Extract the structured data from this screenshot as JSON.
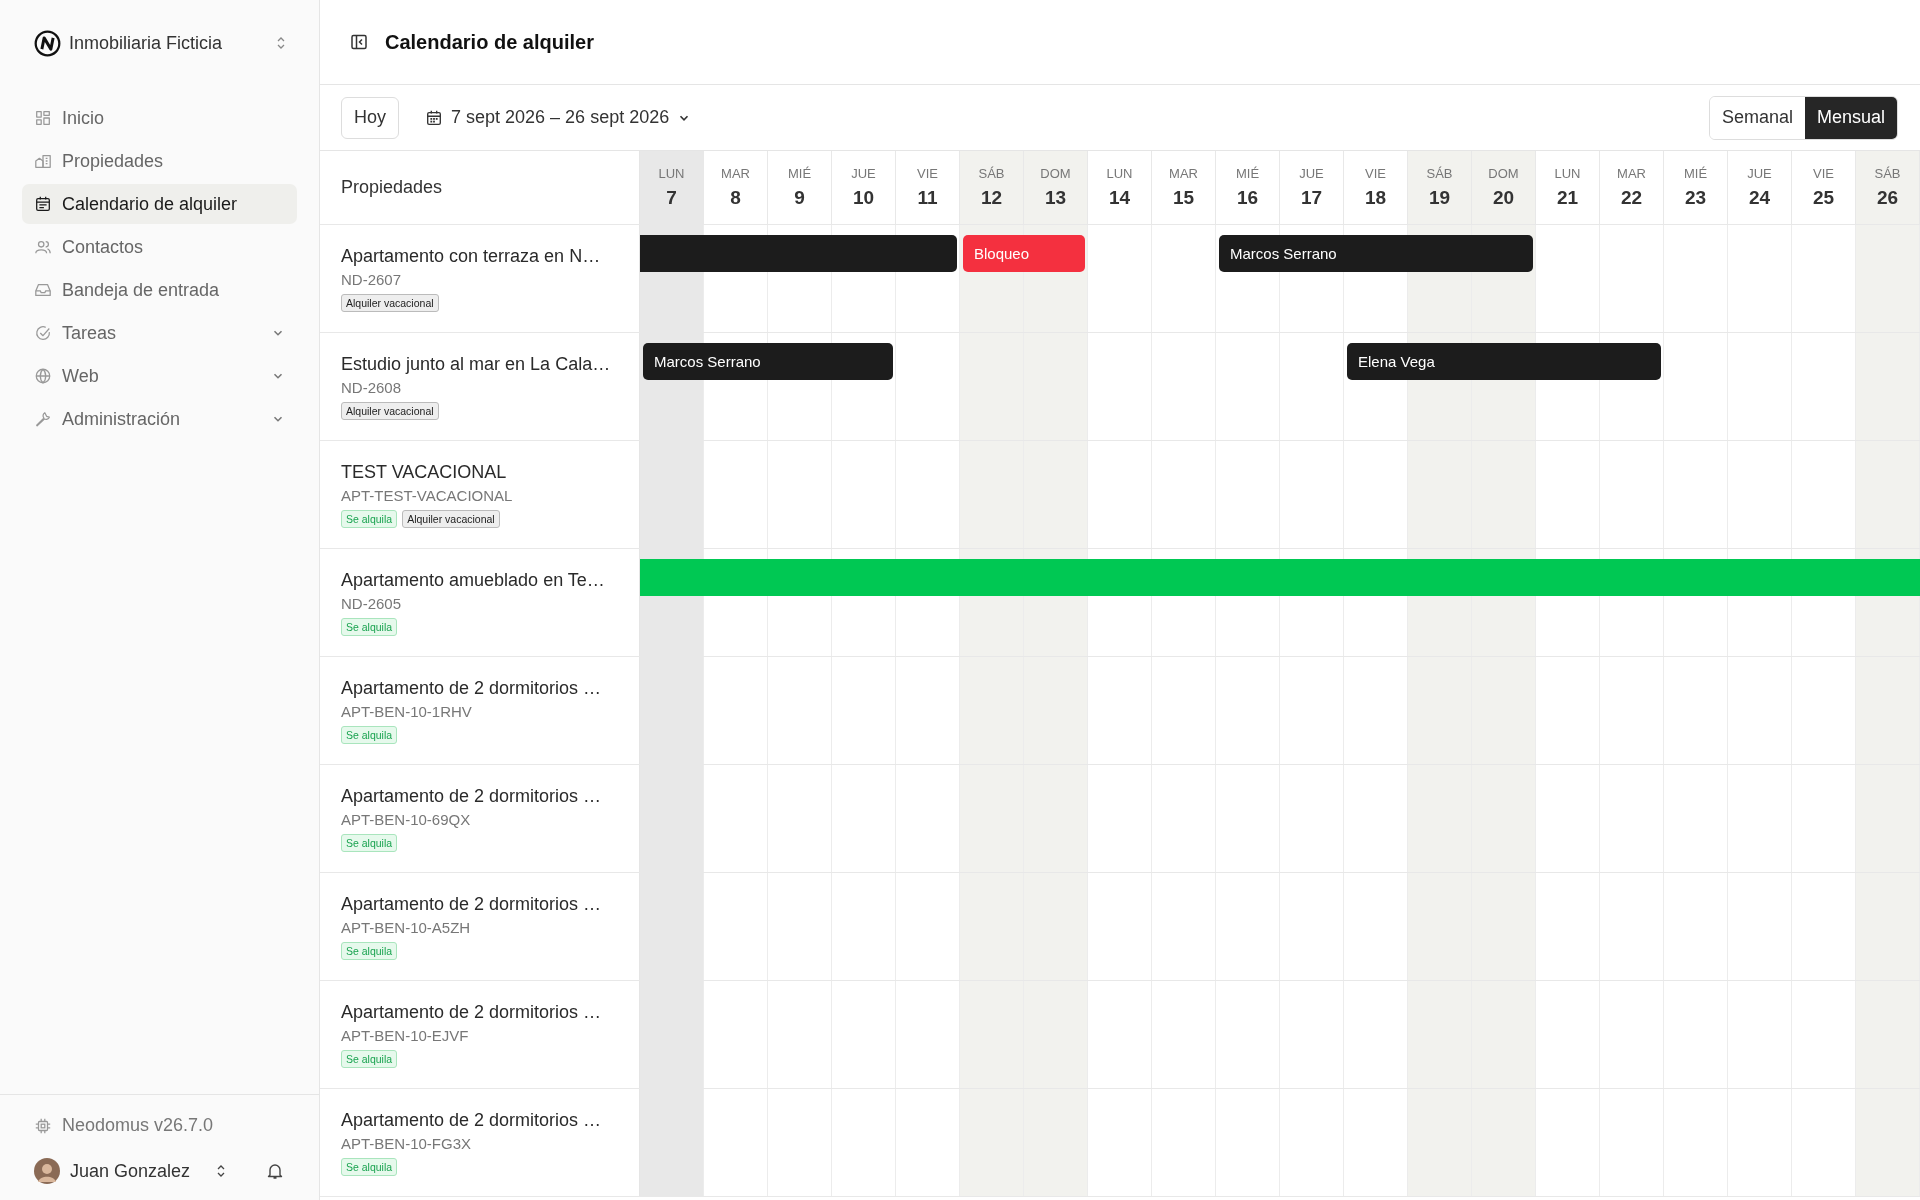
{
  "sidebar": {
    "org": "Inmobiliaria Ficticia",
    "items": [
      {
        "label": "Inicio",
        "selected": false,
        "expandable": false
      },
      {
        "label": "Propiedades",
        "selected": false,
        "expandable": false
      },
      {
        "label": "Calendario de alquiler",
        "selected": true,
        "expandable": false
      },
      {
        "label": "Contactos",
        "selected": false,
        "expandable": false
      },
      {
        "label": "Bandeja de entrada",
        "selected": false,
        "expandable": false
      },
      {
        "label": "Tareas",
        "selected": false,
        "expandable": true
      },
      {
        "label": "Web",
        "selected": false,
        "expandable": true
      },
      {
        "label": "Administración",
        "selected": false,
        "expandable": true
      }
    ],
    "version": "Neodomus v26.7.0",
    "user": "Juan Gonzalez"
  },
  "page_title": "Calendario de alquiler",
  "toolbar": {
    "today_button": "Hoy",
    "range": "7 sept 2026 – 26 sept 2026",
    "views": [
      {
        "label": "Semanal",
        "selected": false
      },
      {
        "label": "Mensual",
        "selected": true
      }
    ]
  },
  "calendar": {
    "properties_heading": "Propiedades",
    "days": [
      {
        "weekday": "LUN",
        "day": "7",
        "today": true,
        "weekend": false
      },
      {
        "weekday": "MAR",
        "day": "8",
        "today": false,
        "weekend": false
      },
      {
        "weekday": "MIÉ",
        "day": "9",
        "today": false,
        "weekend": false
      },
      {
        "weekday": "JUE",
        "day": "10",
        "today": false,
        "weekend": false
      },
      {
        "weekday": "VIE",
        "day": "11",
        "today": false,
        "weekend": false
      },
      {
        "weekday": "SÁB",
        "day": "12",
        "today": false,
        "weekend": true
      },
      {
        "weekday": "DOM",
        "day": "13",
        "today": false,
        "weekend": true
      },
      {
        "weekday": "LUN",
        "day": "14",
        "today": false,
        "weekend": false
      },
      {
        "weekday": "MAR",
        "day": "15",
        "today": false,
        "weekend": false
      },
      {
        "weekday": "MIÉ",
        "day": "16",
        "today": false,
        "weekend": false
      },
      {
        "weekday": "JUE",
        "day": "17",
        "today": false,
        "weekend": false
      },
      {
        "weekday": "VIE",
        "day": "18",
        "today": false,
        "weekend": false
      },
      {
        "weekday": "SÁB",
        "day": "19",
        "today": false,
        "weekend": true
      },
      {
        "weekday": "DOM",
        "day": "20",
        "today": false,
        "weekend": true
      },
      {
        "weekday": "LUN",
        "day": "21",
        "today": false,
        "weekend": false
      },
      {
        "weekday": "MAR",
        "day": "22",
        "today": false,
        "weekend": false
      },
      {
        "weekday": "MIÉ",
        "day": "23",
        "today": false,
        "weekend": false
      },
      {
        "weekday": "JUE",
        "day": "24",
        "today": false,
        "weekend": false
      },
      {
        "weekday": "VIE",
        "day": "25",
        "today": false,
        "weekend": false
      },
      {
        "weekday": "SÁB",
        "day": "26",
        "today": false,
        "weekend": true
      }
    ],
    "properties": [
      {
        "name": "Apartamento con terraza en N…",
        "code": "ND-2607",
        "tags": [
          {
            "label": "Alquiler vacacional",
            "kind": "type"
          }
        ],
        "slots": [
          {
            "kind": "booking"
          },
          {
            "kind": "booking"
          },
          {
            "kind": "booking"
          },
          {
            "kind": "booking"
          },
          {
            "kind": "booking"
          },
          {
            "kind": "block"
          },
          {
            "kind": "block"
          },
          {
            "kind": "free"
          },
          {
            "kind": "free"
          },
          {
            "kind": "booking"
          },
          {
            "kind": "booking"
          },
          {
            "kind": "booking"
          },
          {
            "kind": "booking"
          },
          {
            "kind": "booking"
          },
          {
            "kind": "free"
          },
          {
            "kind": "free"
          },
          {
            "kind": "free"
          },
          {
            "kind": "free"
          },
          {
            "kind": "free"
          },
          {
            "kind": "free"
          }
        ],
        "bars": [
          {
            "continues_before": true,
            "continues_after": false
          },
          {
            "label": "Bloqueo",
            "continues_before": false,
            "continues_after": false
          },
          {
            "label": "Marcos Serrano",
            "continues_before": false,
            "continues_after": false
          }
        ]
      },
      {
        "name": "Estudio junto al mar en La Cala…",
        "code": "ND-2608",
        "tags": [
          {
            "label": "Alquiler vacacional",
            "kind": "type"
          }
        ],
        "slots": [
          {
            "kind": "booking"
          },
          {
            "kind": "booking"
          },
          {
            "kind": "booking"
          },
          {
            "kind": "booking"
          },
          {
            "kind": "free"
          },
          {
            "kind": "free"
          },
          {
            "kind": "free"
          },
          {
            "kind": "free"
          },
          {
            "kind": "free"
          },
          {
            "kind": "free"
          },
          {
            "kind": "free"
          },
          {
            "kind": "booking"
          },
          {
            "kind": "booking"
          },
          {
            "kind": "booking"
          },
          {
            "kind": "booking"
          },
          {
            "kind": "booking"
          },
          {
            "kind": "free"
          },
          {
            "kind": "free"
          },
          {
            "kind": "free"
          },
          {
            "kind": "free"
          }
        ],
        "bars": [
          {
            "label": "Marcos Serrano",
            "continues_before": false,
            "continues_after": false
          },
          {
            "label": "Elena Vega",
            "continues_before": false,
            "continues_after": false
          }
        ]
      },
      {
        "name": "TEST VACACIONAL",
        "code": "APT-TEST-VACACIONAL",
        "tags": [
          {
            "label": "Se alquila",
            "kind": "rent"
          },
          {
            "label": "Alquiler vacacional",
            "kind": "type"
          }
        ]
      },
      {
        "name": "Apartamento amueblado en Te…",
        "code": "ND-2605",
        "tags": [
          {
            "label": "Se alquila",
            "kind": "rent"
          }
        ],
        "slots": [
          {
            "kind": "rental"
          },
          {
            "kind": "rental"
          },
          {
            "kind": "rental"
          },
          {
            "kind": "rental"
          },
          {
            "kind": "rental"
          },
          {
            "kind": "rental"
          },
          {
            "kind": "rental"
          },
          {
            "kind": "rental"
          },
          {
            "kind": "rental"
          },
          {
            "kind": "rental"
          },
          {
            "kind": "rental"
          },
          {
            "kind": "rental"
          },
          {
            "kind": "rental"
          },
          {
            "kind": "rental"
          },
          {
            "kind": "rental"
          },
          {
            "kind": "rental"
          },
          {
            "kind": "rental"
          },
          {
            "kind": "rental"
          },
          {
            "kind": "rental"
          },
          {
            "kind": "rental"
          }
        ],
        "bars": [
          {
            "continues_before": true,
            "continues_after": true
          }
        ]
      },
      {
        "name": "Apartamento de 2 dormitorios …",
        "code": "APT-BEN-10-1RHV",
        "tags": [
          {
            "label": "Se alquila",
            "kind": "rent"
          }
        ]
      },
      {
        "name": "Apartamento de 2 dormitorios …",
        "code": "APT-BEN-10-69QX",
        "tags": [
          {
            "label": "Se alquila",
            "kind": "rent"
          }
        ]
      },
      {
        "name": "Apartamento de 2 dormitorios …",
        "code": "APT-BEN-10-A5ZH",
        "tags": [
          {
            "label": "Se alquila",
            "kind": "rent"
          }
        ]
      },
      {
        "name": "Apartamento de 2 dormitorios …",
        "code": "APT-BEN-10-EJVF",
        "tags": [
          {
            "label": "Se alquila",
            "kind": "rent"
          }
        ]
      },
      {
        "name": "Apartamento de 2 dormitorios …",
        "code": "APT-BEN-10-FG3X",
        "tags": [
          {
            "label": "Se alquila",
            "kind": "rent"
          }
        ]
      }
    ]
  }
}
